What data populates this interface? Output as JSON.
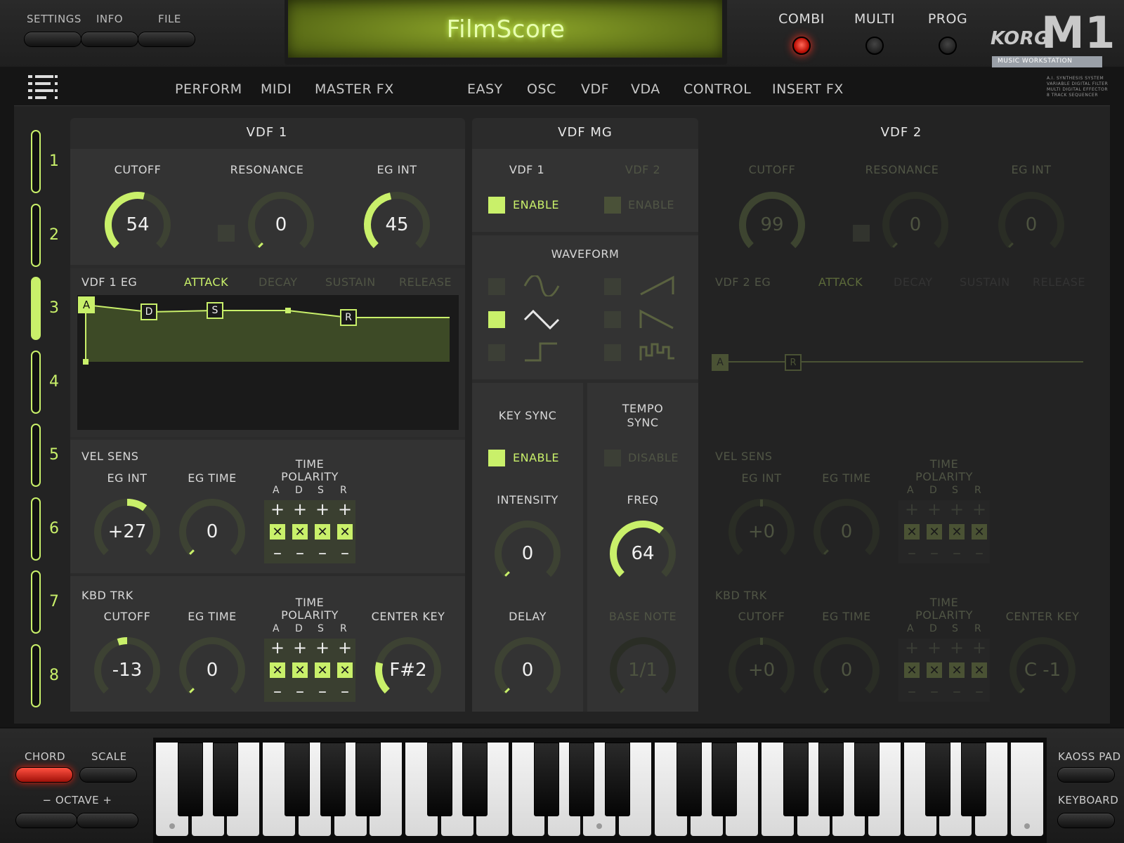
{
  "top": {
    "menu": [
      "SETTINGS",
      "INFO",
      "FILE"
    ],
    "display": "FilmScore",
    "modes": [
      {
        "label": "COMBI",
        "active": true
      },
      {
        "label": "MULTI",
        "active": false
      },
      {
        "label": "PROG",
        "active": false
      }
    ],
    "brand": "KORG",
    "model": "M1",
    "subtitle": "MUSIC WORKSTATION",
    "spec_lines": [
      "A.I. SYNTHESIS SYSTEM",
      "VARIABLE DIGITAL FILTER",
      "MULTI DIGITAL EFFECTOR",
      "8 TRACK SEQUENCER"
    ]
  },
  "nav": {
    "left": [
      "PERFORM",
      "MIDI",
      "MASTER FX"
    ],
    "right": [
      "EASY",
      "OSC",
      "VDF",
      "VDA",
      "CONTROL",
      "INSERT FX"
    ],
    "active": "VDF"
  },
  "tracks": [
    "1",
    "2",
    "3",
    "4",
    "5",
    "6",
    "7",
    "8"
  ],
  "active_track": "3",
  "vdf1": {
    "title": "VDF 1",
    "cutoff_label": "CUTOFF",
    "cutoff": "54",
    "resonance_label": "RESONANCE",
    "resonance": "0",
    "egint_label": "EG INT",
    "egint": "45",
    "eg_label": "VDF 1 EG",
    "eg_stages": [
      "ATTACK",
      "DECAY",
      "SUSTAIN",
      "RELEASE"
    ],
    "eg_points": [
      "A",
      "D",
      "S",
      "R"
    ],
    "vel_label": "VEL SENS",
    "vel_egint_label": "EG INT",
    "vel_egint": "+27",
    "vel_egtime_label": "EG TIME",
    "vel_egtime": "0",
    "time_polarity_label": "TIME POLARITY",
    "adsr": [
      "A",
      "D",
      "S",
      "R"
    ],
    "kbd_label": "KBD TRK",
    "kbd_cutoff_label": "CUTOFF",
    "kbd_cutoff": "-13",
    "kbd_egtime_label": "EG TIME",
    "kbd_egtime": "0",
    "center_key_label": "CENTER KEY",
    "center_key": "F#2"
  },
  "mg": {
    "title": "VDF MG",
    "vdf1": "VDF 1",
    "vdf2": "VDF 2",
    "enable": "ENABLE",
    "waveform": "WAVEFORM",
    "keysync": "KEY SYNC",
    "tempo_sync": "TEMPO SYNC",
    "disable": "DISABLE",
    "intensity_label": "INTENSITY",
    "intensity": "0",
    "freq_label": "FREQ",
    "freq": "64",
    "delay_label": "DELAY",
    "delay": "0",
    "base_note_label": "BASE NOTE",
    "base_note": "1/1"
  },
  "vdf2": {
    "title": "VDF 2",
    "cutoff": "99",
    "resonance": "0",
    "egint": "0",
    "eg_label": "VDF 2 EG",
    "vel_egint": "+0",
    "vel_egtime": "0",
    "kbd_cutoff": "+0",
    "kbd_egtime": "0",
    "center_key": "C -1"
  },
  "bottom": {
    "chord": "CHORD",
    "scale": "SCALE",
    "octave": "−  OCTAVE  +",
    "kaoss": "KAOSS PAD",
    "keyboard": "KEYBOARD"
  },
  "colors": {
    "accent": "#c9f06a",
    "led": "#e8241a"
  }
}
